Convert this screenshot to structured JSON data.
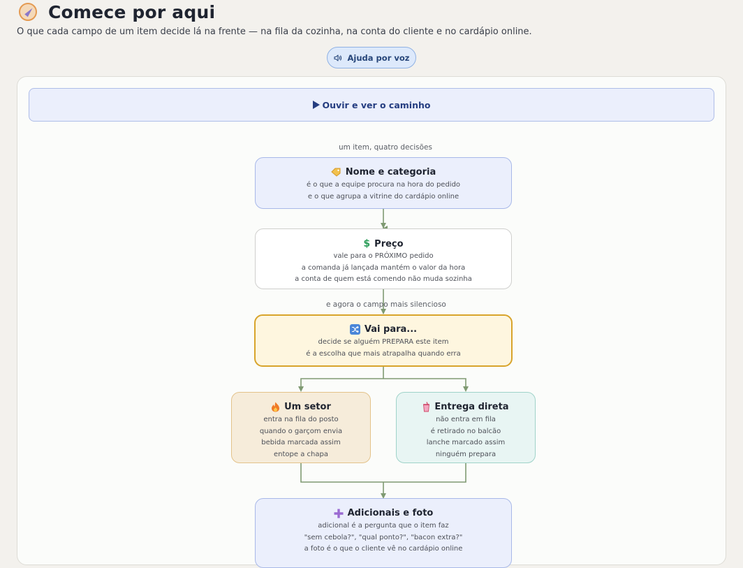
{
  "header": {
    "title": "Comece por aqui",
    "subtitle": "O que cada campo de um item decide lá na frente — na fila da cozinha, na conta do cliente e no cardápio online.",
    "voice_button": "Ajuda por voz"
  },
  "flow": {
    "play_label": "Ouvir e ver o caminho",
    "caption_top": "um item, quatro decisões",
    "caption_mid": "e agora o campo mais silencioso",
    "nodes": {
      "name": {
        "title": "Nome e categoria",
        "icon": "tag-icon",
        "lines": [
          "é o que a equipe procura na hora do pedido",
          "e o que agrupa a vitrine do cardápio online"
        ]
      },
      "price": {
        "title": "Preço",
        "icon": "dollar-icon",
        "lines": [
          "vale para o PRÓXIMO pedido",
          "a comanda já lançada mantém o valor da hora",
          "a conta de quem está comendo não muda sozinha"
        ]
      },
      "route": {
        "title": "Vai para...",
        "icon": "shuffle-icon",
        "lines": [
          "decide se alguém PREPARA este item",
          "é a escolha que mais atrapalha quando erra"
        ]
      },
      "sector": {
        "title": "Um setor",
        "icon": "fire-icon",
        "lines": [
          "entra na fila do posto",
          "quando o garçom envia",
          "bebida marcada assim",
          "entope a chapa"
        ]
      },
      "direct": {
        "title": "Entrega direta",
        "icon": "drink-icon",
        "lines": [
          "não entra em fila",
          "é retirado no balcão",
          "lanche marcado assim",
          "ninguém prepara"
        ]
      },
      "addons": {
        "title": "Adicionais e foto",
        "icon": "plus-icon",
        "lines": [
          "adicional é a pergunta que o item faz",
          "\"sem cebola?\", \"qual ponto?\", \"bacon extra?\"",
          "a foto é o que o cliente vê no cardápio online"
        ]
      }
    }
  },
  "colors": {
    "arrow": "#7f9a72",
    "accent_blue": "#253d80",
    "route_border": "#d8a42b"
  }
}
